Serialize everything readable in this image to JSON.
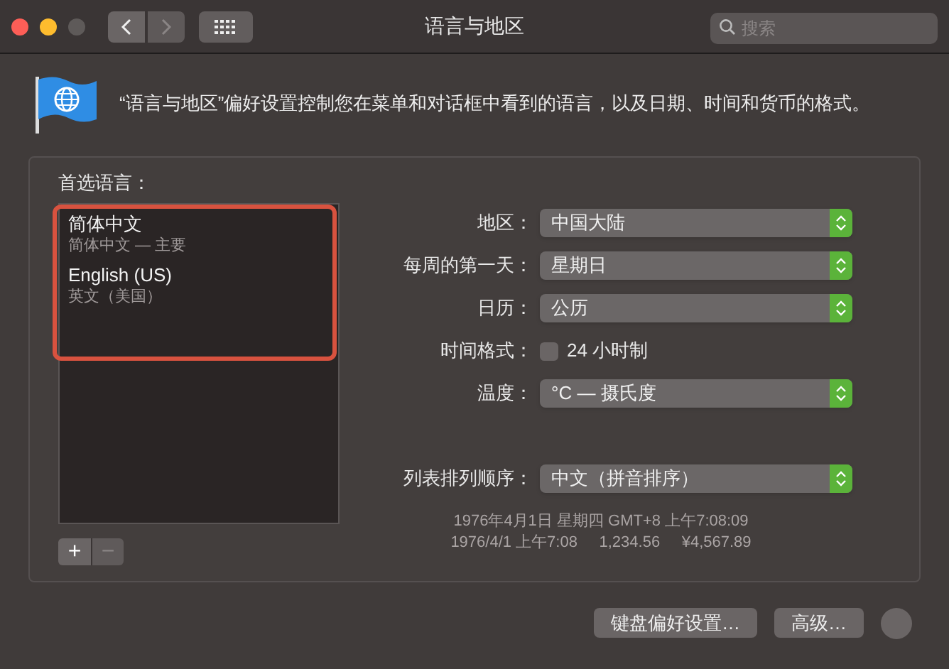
{
  "window": {
    "title": "语言与地区",
    "back_disabled": false,
    "forward_disabled": true
  },
  "search": {
    "placeholder": "搜索"
  },
  "description": "“语言与地区”偏好设置控制您在菜单和对话框中看到的语言，以及日期、时间和货币的格式。",
  "preferred_languages": {
    "label": "首选语言：",
    "highlight_frame": true,
    "items": [
      {
        "name": "简体中文",
        "detail": "简体中文 — 主要"
      },
      {
        "name": "English (US)",
        "detail": "英文（美国）"
      }
    ],
    "add": {
      "label": "+",
      "disabled": false
    },
    "remove": {
      "label": "−",
      "disabled": true
    }
  },
  "settings": [
    {
      "kind": "popup",
      "label": "地区：",
      "value": "中国大陆"
    },
    {
      "kind": "popup",
      "label": "每周的第一天：",
      "value": "星期日"
    },
    {
      "kind": "popup",
      "label": "日历：",
      "value": "公历"
    },
    {
      "kind": "checkbox",
      "label": "时间格式：",
      "value": "24 小时制",
      "checked": false
    },
    {
      "kind": "popup",
      "label": "温度：",
      "value": "°C — 摄氏度"
    },
    {
      "kind": "spacer"
    },
    {
      "kind": "popup",
      "label": "列表排列顺序：",
      "value": "中文（拼音排序）"
    }
  ],
  "samples": [
    "1976年4月1日 星期四 GMT+8 上午7:08:09",
    "1976/4/1 上午7:08     1,234.56     ¥4,567.89"
  ],
  "buttons": [
    "键盘偏好设置…",
    "高级…"
  ]
}
